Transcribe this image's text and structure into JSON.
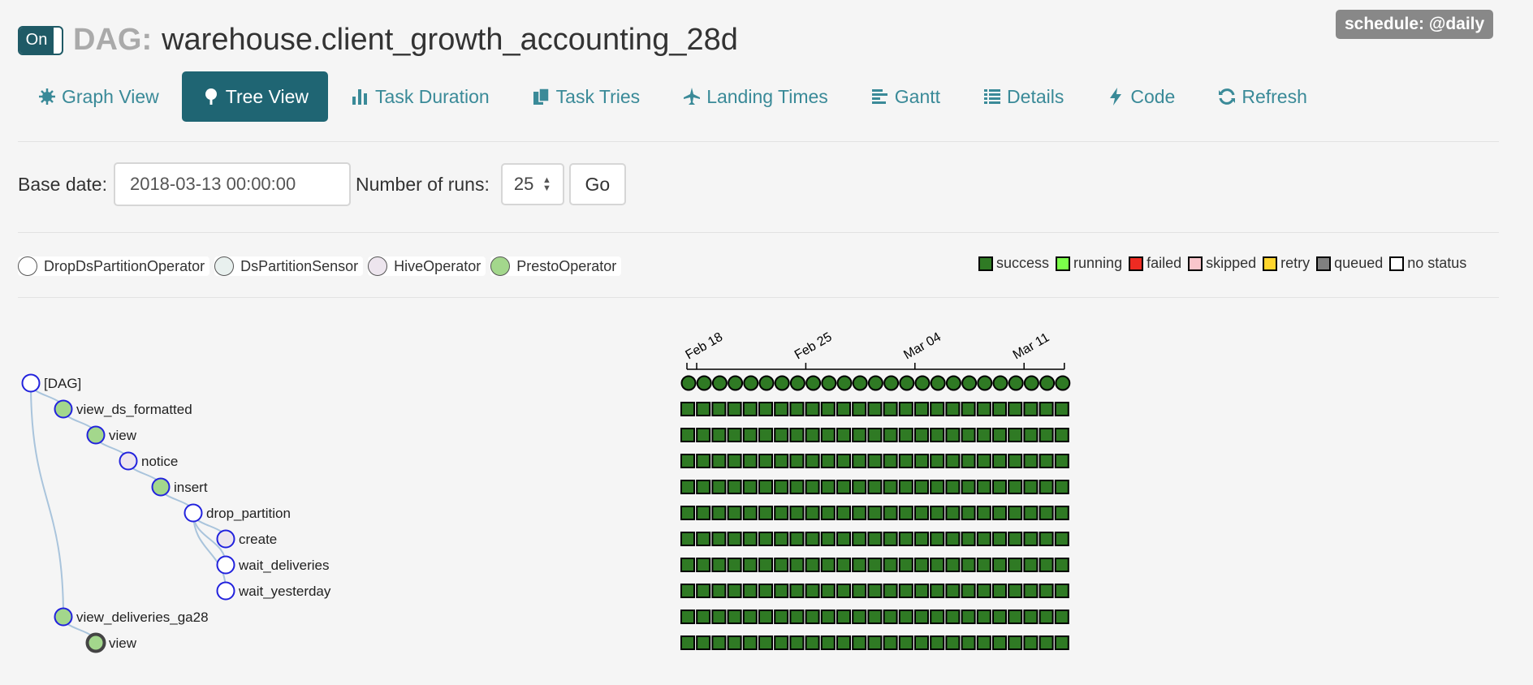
{
  "header": {
    "toggle_label": "On",
    "dag_prefix": "DAG:",
    "dag_name": "warehouse.client_growth_accounting_28d",
    "schedule": "schedule: @daily"
  },
  "nav": {
    "tabs": [
      {
        "label": "Graph View",
        "icon": "graph-icon"
      },
      {
        "label": "Tree View",
        "icon": "tree-icon",
        "active": true
      },
      {
        "label": "Task Duration",
        "icon": "bar-chart-icon"
      },
      {
        "label": "Task Tries",
        "icon": "files-icon"
      },
      {
        "label": "Landing Times",
        "icon": "plane-icon"
      },
      {
        "label": "Gantt",
        "icon": "gantt-icon"
      },
      {
        "label": "Details",
        "icon": "list-icon"
      },
      {
        "label": "Code",
        "icon": "bolt-icon"
      },
      {
        "label": "Refresh",
        "icon": "refresh-icon"
      }
    ]
  },
  "form": {
    "base_date_label": "Base date:",
    "base_date_value": "2018-03-13 00:00:00",
    "runs_label": "Number of runs:",
    "runs_value": "25",
    "go_label": "Go"
  },
  "operators": [
    {
      "name": "DropDsPartitionOperator",
      "color": "#ffffff"
    },
    {
      "name": "DsPartitionSensor",
      "color": "#e8f0ee"
    },
    {
      "name": "HiveOperator",
      "color": "#ede5ee"
    },
    {
      "name": "PrestoOperator",
      "color": "#a3d78c"
    }
  ],
  "states": [
    {
      "name": "success",
      "color": "#2f7a24"
    },
    {
      "name": "running",
      "color": "#7cff4a"
    },
    {
      "name": "failed",
      "color": "#ee2b22"
    },
    {
      "name": "skipped",
      "color": "#f8c6cc"
    },
    {
      "name": "retry",
      "color": "#ffd62e"
    },
    {
      "name": "queued",
      "color": "#808080"
    },
    {
      "name": "no status",
      "color": "#ffffff"
    }
  ],
  "timeline": {
    "axis_labels": [
      "Feb 18",
      "Feb 25",
      "Mar 04",
      "Mar 11"
    ],
    "runs": 25,
    "all_runs_state": "success"
  },
  "tree": [
    {
      "label": "[DAG]",
      "depth": 0,
      "fill": "#ffffff"
    },
    {
      "label": "view_ds_formatted",
      "depth": 1,
      "fill": "#a3d78c"
    },
    {
      "label": "view",
      "depth": 2,
      "fill": "#a3d78c"
    },
    {
      "label": "notice",
      "depth": 3,
      "fill": "#ede5ee"
    },
    {
      "label": "insert",
      "depth": 4,
      "fill": "#a3d78c"
    },
    {
      "label": "drop_partition",
      "depth": 5,
      "fill": "#ffffff"
    },
    {
      "label": "create",
      "depth": 6,
      "fill": "#ede5ee"
    },
    {
      "label": "wait_deliveries",
      "depth": 6,
      "fill": "#ffffff"
    },
    {
      "label": "wait_yesterday",
      "depth": 6,
      "fill": "#ffffff"
    },
    {
      "label": "view_deliveries_ga28",
      "depth": 1,
      "fill": "#a3d78c"
    },
    {
      "label": "view",
      "depth": 2,
      "fill": "#a3d78c",
      "collapsed": true
    }
  ]
}
